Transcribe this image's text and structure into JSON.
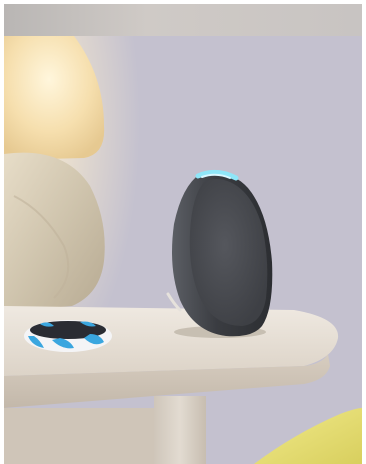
{
  "scene": {
    "colors": {
      "wall": "#c4c1cf",
      "lamp_glow": "#fbe6b8",
      "lamp_base": "#d9d0bd",
      "table_top": "#e9e2d8",
      "table_leg": "#d6cec3",
      "speaker_body": "#3d3f44",
      "speaker_mesh": "#4a4c52",
      "speaker_light": "#6fd6f0",
      "bracelet_blue": "#3aa6df",
      "bracelet_white": "#f4f4f6",
      "blanket": "#e9e27a"
    }
  }
}
